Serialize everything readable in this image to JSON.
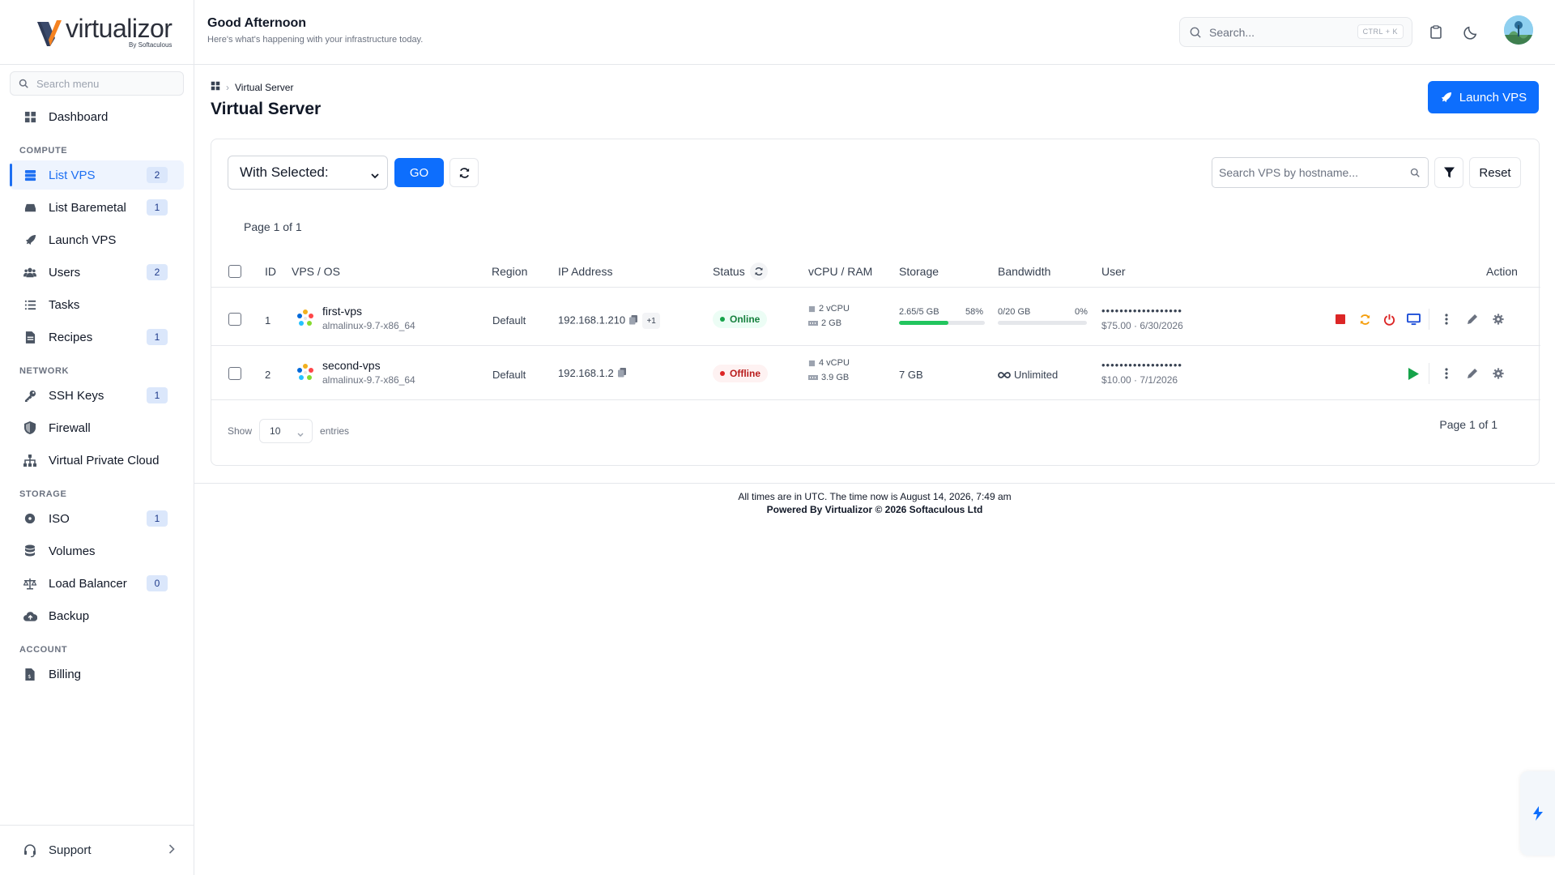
{
  "brand": {
    "name": "virtualizor",
    "sub": "By Softaculous"
  },
  "sidebar": {
    "search_placeholder": "Search menu",
    "sections": {
      "compute": "COMPUTE",
      "network": "NETWORK",
      "storage": "STORAGE",
      "account": "ACCOUNT"
    },
    "items": {
      "dashboard": {
        "label": "Dashboard",
        "icon": "grid-icon"
      },
      "list_vps": {
        "label": "List VPS",
        "badge": "2",
        "icon": "server-icon"
      },
      "list_baremetal": {
        "label": "List Baremetal",
        "badge": "1",
        "icon": "hdd-icon"
      },
      "launch_vps": {
        "label": "Launch VPS",
        "icon": "rocket-icon"
      },
      "users": {
        "label": "Users",
        "badge": "2",
        "icon": "users-icon"
      },
      "tasks": {
        "label": "Tasks",
        "icon": "list-icon"
      },
      "recipes": {
        "label": "Recipes",
        "badge": "1",
        "icon": "file-icon"
      },
      "ssh_keys": {
        "label": "SSH Keys",
        "badge": "1",
        "icon": "key-icon"
      },
      "firewall": {
        "label": "Firewall",
        "icon": "shield-icon"
      },
      "vpc": {
        "label": "Virtual Private Cloud",
        "icon": "sitemap-icon"
      },
      "iso": {
        "label": "ISO",
        "badge": "1",
        "icon": "disc-icon"
      },
      "volumes": {
        "label": "Volumes",
        "icon": "database-icon"
      },
      "load_balancer": {
        "label": "Load Balancer",
        "badge": "0",
        "icon": "scale-icon"
      },
      "backup": {
        "label": "Backup",
        "icon": "cloud-upload-icon"
      },
      "billing": {
        "label": "Billing",
        "icon": "invoice-icon"
      }
    },
    "support": "Support"
  },
  "header": {
    "greeting": "Good Afternoon",
    "subtitle": "Here's what's happening with your infrastructure today.",
    "search_placeholder": "Search...",
    "shortcut": "CTRL + K"
  },
  "breadcrumb": {
    "current": "Virtual Server"
  },
  "page_title": "Virtual Server",
  "launch_button": "Launch VPS",
  "toolbar": {
    "with_selected": "With Selected:",
    "go": "GO",
    "search_placeholder": "Search VPS by hostname...",
    "reset": "Reset"
  },
  "page_info": "Page 1 of 1",
  "table": {
    "columns": {
      "id": "ID",
      "vps_os": "VPS / OS",
      "region": "Region",
      "ip": "IP Address",
      "status": "Status",
      "vcpu_ram": "vCPU / RAM",
      "storage": "Storage",
      "bandwidth": "Bandwidth",
      "user": "User",
      "action": "Action"
    },
    "rows": [
      {
        "id": "1",
        "hostname": "first-vps",
        "os": "almalinux-9.7-x86_64",
        "region": "Default",
        "ip": "192.168.1.210",
        "extra_ips": "+1",
        "status": "Online",
        "vcpu": "2 vCPU",
        "ram": "2 GB",
        "storage_text": "2.65/5 GB",
        "storage_pct_text": "58%",
        "storage_fraction": 0.58,
        "bandwidth_text": "0/20 GB",
        "bandwidth_pct_text": "0%",
        "bandwidth_fraction": 0.0,
        "user": "••••••••••••••••••",
        "price": "$75.00 · 6/30/2026"
      },
      {
        "id": "2",
        "hostname": "second-vps",
        "os": "almalinux-9.7-x86_64",
        "region": "Default",
        "ip": "192.168.1.2",
        "status": "Offline",
        "vcpu": "4 vCPU",
        "ram": "3.9 GB",
        "storage_text": "7 GB",
        "bandwidth_text": "Unlimited",
        "user": "••••••••••••••••••",
        "price": "$10.00 · 7/1/2026"
      }
    ]
  },
  "pagination": {
    "show": "Show",
    "entries_value": "10",
    "entries": "entries",
    "page_info": "Page 1 of 1"
  },
  "footer": {
    "line1": "All times are in UTC. The time now is August 14, 2026, 7:49 am",
    "line2": "Powered By Virtualizor © 2026 Softaculous Ltd"
  },
  "colors": {
    "primary": "#0d6efd",
    "online": "#16a34a",
    "offline": "#dc2626",
    "stop": "#dc2626",
    "restart": "#f59e0b",
    "start": "#16a34a"
  }
}
